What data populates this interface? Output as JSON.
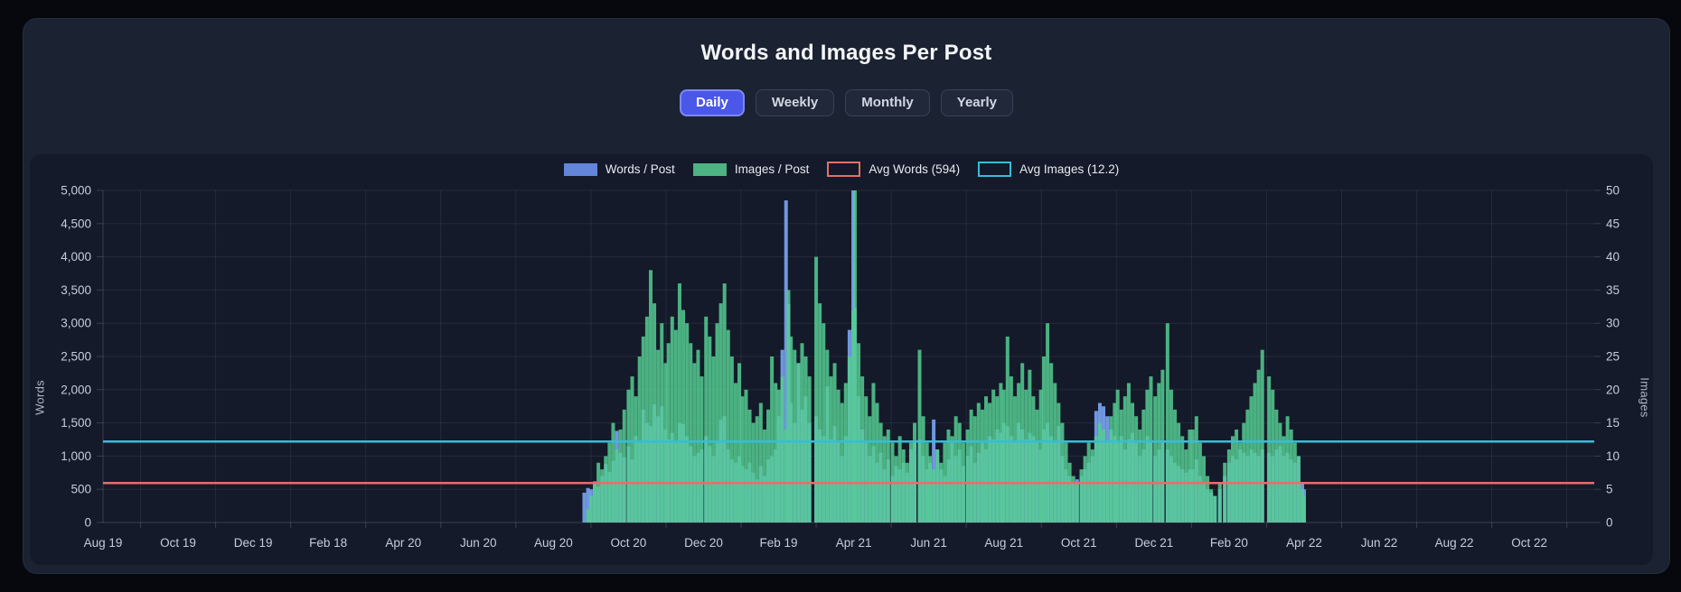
{
  "controls": {
    "buttons": [
      {
        "label": "Daily",
        "active": true
      },
      {
        "label": "Weekly",
        "active": false
      },
      {
        "label": "Monthly",
        "active": false
      },
      {
        "label": "Yearly",
        "active": false
      }
    ]
  },
  "colors": {
    "page_bg": "#06080e",
    "card_bg": "#1b2231",
    "panel_bg": "#141a29",
    "words_bar": "#7aa2f0",
    "images_bar": "#55cd92",
    "words_legend": "#6385da",
    "images_legend": "#4cb383",
    "avg_words_line": "#e56f68",
    "avg_images_line": "#38bcd9",
    "active_button": "#4a57e8",
    "grid": "rgba(255,255,255,0.07)",
    "tick_text": "#c6ccd8"
  },
  "chart_data": {
    "type": "bar",
    "title": "Words and Images Per Post",
    "x_axis": {
      "tick_labels": [
        "Aug 19",
        "Oct 19",
        "Dec 19",
        "Feb 18",
        "Apr 20",
        "Jun 20",
        "Aug 20",
        "Oct 20",
        "Dec 20",
        "Feb 19",
        "Apr 21",
        "Jun 21",
        "Aug 21",
        "Oct 21",
        "Dec 21",
        "Feb 20",
        "Apr 22",
        "Jun 22",
        "Aug 22",
        "Oct 22"
      ],
      "start_month": "Aug 2019",
      "months_per_tick": 2,
      "grid": true
    },
    "y_left": {
      "label": "Words",
      "min": 0,
      "max": 5000,
      "step": 500,
      "tick_labels": [
        "0",
        "500",
        "1,000",
        "1,500",
        "2,000",
        "2,500",
        "3,000",
        "3,500",
        "4,000",
        "4,500",
        "5,000"
      ]
    },
    "y_right": {
      "label": "Images",
      "min": 0,
      "max": 50,
      "step": 5,
      "tick_labels": [
        "0",
        "5",
        "10",
        "15",
        "20",
        "25",
        "30",
        "35",
        "40",
        "45",
        "50"
      ]
    },
    "series": [
      {
        "name": "Words / Post",
        "axis": "left",
        "color": "#7aa2f0",
        "legend_color": "#6385da",
        "style": "fill"
      },
      {
        "name": "Images / Post",
        "axis": "right",
        "color": "#55cd92",
        "legend_color": "#4cb383",
        "style": "fill"
      }
    ],
    "avg_lines": [
      {
        "name": "Avg Words (594)",
        "value": 594,
        "axis": "left",
        "color": "#e56f68"
      },
      {
        "name": "Avg Images (12.2)",
        "value": 12.2,
        "axis": "right",
        "color": "#38bcd9"
      }
    ],
    "legend_position": "top",
    "points": [
      [
        "2020-08-26",
        450,
        0
      ],
      [
        "2020-08-29",
        520,
        2
      ],
      [
        "2020-09-01",
        500,
        4
      ],
      [
        "2020-09-04",
        620,
        6
      ],
      [
        "2020-09-07",
        540,
        9
      ],
      [
        "2020-09-10",
        700,
        8
      ],
      [
        "2020-09-13",
        880,
        10
      ],
      [
        "2020-09-16",
        760,
        12
      ],
      [
        "2020-09-19",
        930,
        15
      ],
      [
        "2020-09-22",
        1380,
        11
      ],
      [
        "2020-09-25",
        1050,
        14
      ],
      [
        "2020-09-28",
        980,
        17
      ],
      [
        "2020-10-01",
        1150,
        20
      ],
      [
        "2020-10-04",
        950,
        22
      ],
      [
        "2020-10-07",
        1300,
        19
      ],
      [
        "2020-10-10",
        1200,
        25
      ],
      [
        "2020-10-13",
        1700,
        28
      ],
      [
        "2020-10-16",
        1500,
        31
      ],
      [
        "2020-10-19",
        1450,
        38
      ],
      [
        "2020-10-22",
        1780,
        33
      ],
      [
        "2020-10-25",
        1600,
        26
      ],
      [
        "2020-10-28",
        1750,
        30
      ],
      [
        "2020-10-31",
        1400,
        24
      ],
      [
        "2020-11-03",
        1250,
        27
      ],
      [
        "2020-11-06",
        1350,
        31
      ],
      [
        "2020-11-09",
        1200,
        29
      ],
      [
        "2020-11-12",
        1500,
        36
      ],
      [
        "2020-11-15",
        1480,
        32
      ],
      [
        "2020-11-18",
        1300,
        30
      ],
      [
        "2020-11-21",
        1150,
        27
      ],
      [
        "2020-11-24",
        1000,
        24
      ],
      [
        "2020-11-27",
        1050,
        26
      ],
      [
        "2020-11-30",
        1100,
        22
      ],
      [
        "2020-12-03",
        1300,
        31
      ],
      [
        "2020-12-06",
        1150,
        28
      ],
      [
        "2020-12-09",
        1000,
        25
      ],
      [
        "2020-12-12",
        1200,
        30
      ],
      [
        "2020-12-15",
        1550,
        33
      ],
      [
        "2020-12-18",
        1600,
        36
      ],
      [
        "2020-12-21",
        1100,
        29
      ],
      [
        "2020-12-24",
        950,
        25
      ],
      [
        "2020-12-27",
        900,
        21
      ],
      [
        "2020-12-30",
        1000,
        24
      ],
      [
        "2021-01-02",
        850,
        19
      ],
      [
        "2021-01-05",
        800,
        20
      ],
      [
        "2021-01-08",
        900,
        17
      ],
      [
        "2021-01-11",
        750,
        15
      ],
      [
        "2021-01-14",
        650,
        16
      ],
      [
        "2021-01-17",
        850,
        18
      ],
      [
        "2021-01-20",
        700,
        14
      ],
      [
        "2021-01-23",
        950,
        17
      ],
      [
        "2021-01-26",
        1000,
        25
      ],
      [
        "2021-01-29",
        1100,
        21
      ],
      [
        "2021-02-01",
        1600,
        20
      ],
      [
        "2021-02-04",
        2600,
        22
      ],
      [
        "2021-02-07",
        4850,
        14
      ],
      [
        "2021-02-09",
        3290,
        35
      ],
      [
        "2021-02-11",
        1800,
        28
      ],
      [
        "2021-02-14",
        1500,
        26
      ],
      [
        "2021-02-17",
        2400,
        24
      ],
      [
        "2021-02-20",
        1700,
        27
      ],
      [
        "2021-02-23",
        1900,
        25
      ],
      [
        "2021-02-26",
        1500,
        22
      ],
      [
        "2021-03-01",
        1600,
        40
      ],
      [
        "2021-03-04",
        1400,
        33
      ],
      [
        "2021-03-07",
        1300,
        30
      ],
      [
        "2021-03-10",
        2050,
        26
      ],
      [
        "2021-03-13",
        1250,
        22
      ],
      [
        "2021-03-16",
        1450,
        24
      ],
      [
        "2021-03-19",
        1200,
        20
      ],
      [
        "2021-03-22",
        1000,
        18
      ],
      [
        "2021-03-25",
        1300,
        21
      ],
      [
        "2021-03-28",
        2900,
        25
      ],
      [
        "2021-03-31",
        5000,
        32
      ],
      [
        "2021-04-02",
        3230,
        50
      ],
      [
        "2021-04-05",
        1900,
        27
      ],
      [
        "2021-04-08",
        1400,
        22
      ],
      [
        "2021-04-11",
        1200,
        19
      ],
      [
        "2021-04-14",
        1000,
        16
      ],
      [
        "2021-04-17",
        1150,
        21
      ],
      [
        "2021-04-20",
        900,
        18
      ],
      [
        "2021-04-23",
        1050,
        15
      ],
      [
        "2021-04-26",
        800,
        13
      ],
      [
        "2021-04-29",
        950,
        14
      ],
      [
        "2021-05-02",
        700,
        12
      ],
      [
        "2021-05-05",
        850,
        10
      ],
      [
        "2021-05-08",
        800,
        13
      ],
      [
        "2021-05-11",
        900,
        11
      ],
      [
        "2021-05-14",
        750,
        9
      ],
      [
        "2021-05-17",
        1100,
        12
      ],
      [
        "2021-05-20",
        1200,
        15
      ],
      [
        "2021-05-24",
        1250,
        26
      ],
      [
        "2021-05-27",
        1000,
        16
      ],
      [
        "2021-05-30",
        800,
        12
      ],
      [
        "2021-06-02",
        900,
        10
      ],
      [
        "2021-06-05",
        1550,
        8
      ],
      [
        "2021-06-08",
        1100,
        11
      ],
      [
        "2021-06-11",
        800,
        9
      ],
      [
        "2021-06-14",
        700,
        12
      ],
      [
        "2021-06-17",
        950,
        14
      ],
      [
        "2021-06-20",
        1200,
        13
      ],
      [
        "2021-06-23",
        1000,
        16
      ],
      [
        "2021-06-26",
        1100,
        15
      ],
      [
        "2021-06-29",
        850,
        12
      ],
      [
        "2021-07-02",
        1000,
        14
      ],
      [
        "2021-07-05",
        1150,
        17
      ],
      [
        "2021-07-08",
        900,
        16
      ],
      [
        "2021-07-11",
        1050,
        18
      ],
      [
        "2021-07-14",
        1200,
        17
      ],
      [
        "2021-07-17",
        1100,
        19
      ],
      [
        "2021-07-20",
        1300,
        18
      ],
      [
        "2021-07-23",
        1250,
        20
      ],
      [
        "2021-07-26",
        1400,
        19
      ],
      [
        "2021-07-29",
        1350,
        21
      ],
      [
        "2021-08-01",
        1500,
        20
      ],
      [
        "2021-08-04",
        1450,
        28
      ],
      [
        "2021-08-07",
        1300,
        22
      ],
      [
        "2021-08-10",
        1200,
        19
      ],
      [
        "2021-08-13",
        1500,
        21
      ],
      [
        "2021-08-16",
        1400,
        24
      ],
      [
        "2021-08-19",
        1250,
        20
      ],
      [
        "2021-08-22",
        1350,
        23
      ],
      [
        "2021-08-25",
        1300,
        19
      ],
      [
        "2021-08-28",
        1200,
        17
      ],
      [
        "2021-08-31",
        1100,
        20
      ],
      [
        "2021-09-03",
        1400,
        25
      ],
      [
        "2021-09-06",
        1500,
        30
      ],
      [
        "2021-09-09",
        1300,
        24
      ],
      [
        "2021-09-12",
        1200,
        21
      ],
      [
        "2021-09-15",
        1450,
        18
      ],
      [
        "2021-09-18",
        1000,
        15
      ],
      [
        "2021-09-21",
        800,
        12
      ],
      [
        "2021-09-24",
        700,
        9
      ],
      [
        "2021-09-27",
        600,
        7
      ],
      [
        "2021-09-30",
        650,
        6
      ],
      [
        "2021-10-03",
        700,
        8
      ],
      [
        "2021-10-06",
        800,
        10
      ],
      [
        "2021-10-09",
        900,
        12
      ],
      [
        "2021-10-12",
        1000,
        11
      ],
      [
        "2021-10-15",
        1680,
        13
      ],
      [
        "2021-10-18",
        1800,
        15
      ],
      [
        "2021-10-21",
        1750,
        14
      ],
      [
        "2021-10-24",
        1600,
        12
      ],
      [
        "2021-10-27",
        1400,
        16
      ],
      [
        "2021-10-30",
        1300,
        18
      ],
      [
        "2021-11-02",
        1200,
        20
      ],
      [
        "2021-11-05",
        1300,
        17
      ],
      [
        "2021-11-08",
        1100,
        19
      ],
      [
        "2021-11-11",
        1250,
        21
      ],
      [
        "2021-11-14",
        1350,
        18
      ],
      [
        "2021-11-17",
        1200,
        16
      ],
      [
        "2021-11-20",
        1000,
        14
      ],
      [
        "2021-11-23",
        1100,
        17
      ],
      [
        "2021-11-26",
        1300,
        20
      ],
      [
        "2021-11-29",
        1200,
        22
      ],
      [
        "2021-12-02",
        1000,
        19
      ],
      [
        "2021-12-05",
        1100,
        21
      ],
      [
        "2021-12-08",
        1200,
        23
      ],
      [
        "2021-12-12",
        1100,
        30
      ],
      [
        "2021-12-15",
        1000,
        20
      ],
      [
        "2021-12-18",
        900,
        17
      ],
      [
        "2021-12-21",
        850,
        15
      ],
      [
        "2021-12-24",
        800,
        13
      ],
      [
        "2021-12-27",
        750,
        11
      ],
      [
        "2021-12-30",
        800,
        14
      ],
      [
        "2022-01-02",
        800,
        14
      ],
      [
        "2022-01-05",
        950,
        16
      ],
      [
        "2022-01-08",
        700,
        12
      ],
      [
        "2022-01-11",
        600,
        10
      ],
      [
        "2022-01-14",
        500,
        7
      ],
      [
        "2022-01-17",
        450,
        5
      ],
      [
        "2022-01-20",
        400,
        4
      ],
      [
        "2022-01-24",
        500,
        6
      ],
      [
        "2022-01-28",
        700,
        9
      ],
      [
        "2022-02-01",
        900,
        11
      ],
      [
        "2022-02-04",
        1000,
        13
      ],
      [
        "2022-02-07",
        950,
        14
      ],
      [
        "2022-02-10",
        1100,
        12
      ],
      [
        "2022-02-13",
        1050,
        15
      ],
      [
        "2022-02-16",
        1000,
        17
      ],
      [
        "2022-02-19",
        1100,
        19
      ],
      [
        "2022-02-22",
        1050,
        21
      ],
      [
        "2022-02-25",
        1000,
        23
      ],
      [
        "2022-02-28",
        1100,
        26
      ],
      [
        "2022-03-03",
        1050,
        22
      ],
      [
        "2022-03-06",
        1000,
        20
      ],
      [
        "2022-03-09",
        1100,
        17
      ],
      [
        "2022-03-12",
        1150,
        15
      ],
      [
        "2022-03-15",
        1000,
        13
      ],
      [
        "2022-03-18",
        1050,
        16
      ],
      [
        "2022-03-21",
        950,
        14
      ],
      [
        "2022-03-24",
        900,
        12
      ],
      [
        "2022-03-27",
        1000,
        10
      ],
      [
        "2022-03-30",
        600,
        5
      ],
      [
        "2022-04-01",
        500,
        4
      ]
    ]
  }
}
